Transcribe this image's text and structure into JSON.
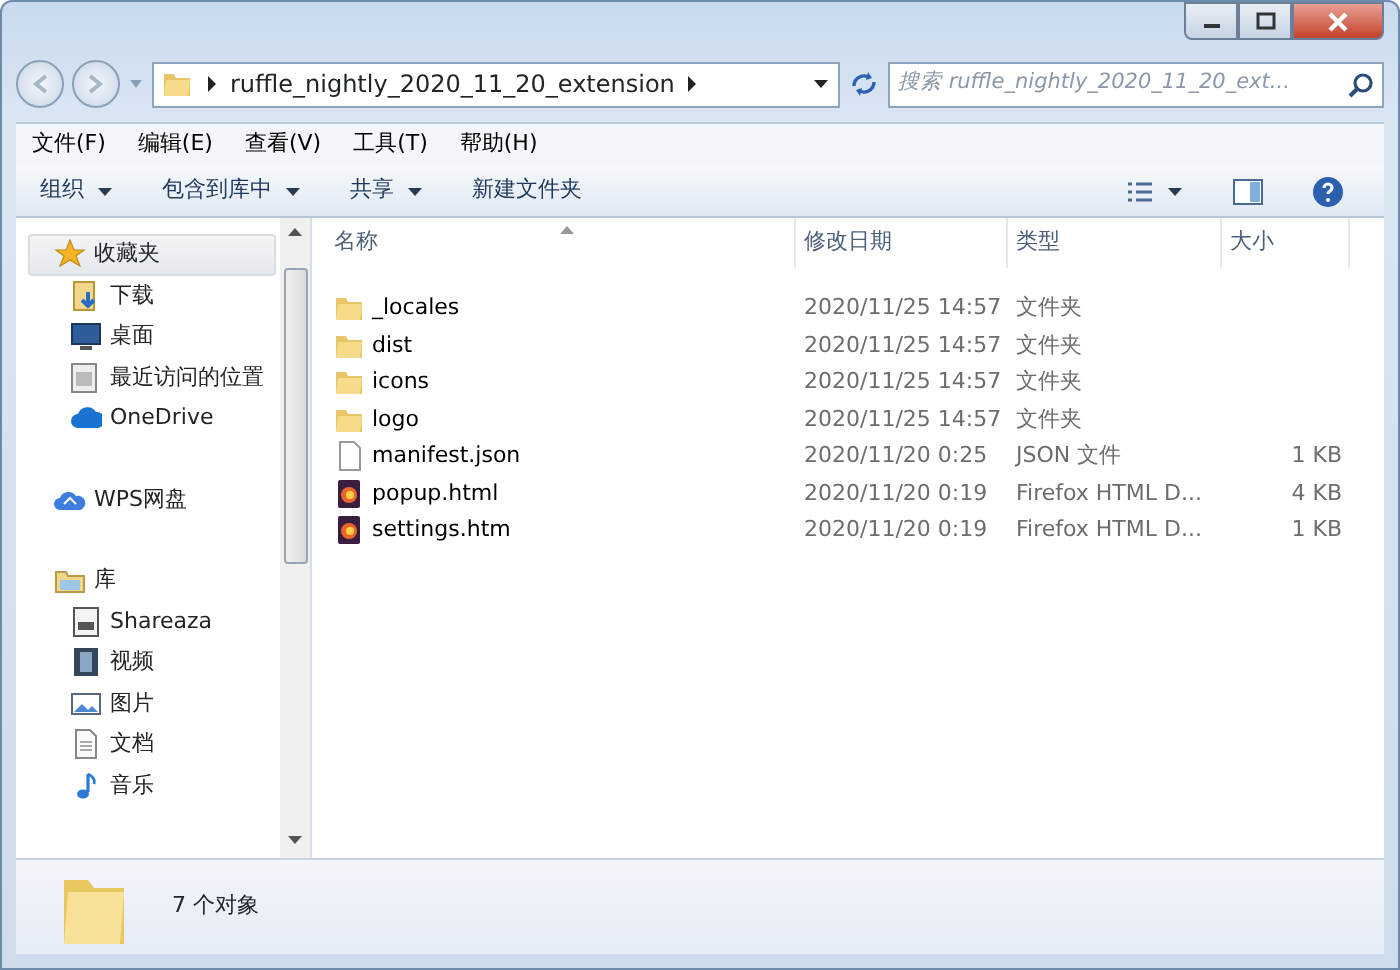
{
  "address": {
    "crumbs": [
      "ruffle_nightly_2020_11_20_extension"
    ]
  },
  "search": {
    "placeholder": "搜索 ruffle_nightly_2020_11_20_ext..."
  },
  "menu": [
    "文件(F)",
    "编辑(E)",
    "查看(V)",
    "工具(T)",
    "帮助(H)"
  ],
  "toolbar": [
    {
      "label": "组织",
      "dropdown": true
    },
    {
      "label": "包含到库中",
      "dropdown": true
    },
    {
      "label": "共享",
      "dropdown": true
    },
    {
      "label": "新建文件夹",
      "dropdown": false
    }
  ],
  "sidebar": [
    {
      "label": "收藏夹",
      "kind": "star",
      "selected": true,
      "children": [
        {
          "label": "下载",
          "kind": "download",
          "selected": false
        },
        {
          "label": "桌面",
          "kind": "desktop",
          "selected": false
        },
        {
          "label": "最近访问的位置",
          "kind": "recent",
          "selected": false
        },
        {
          "label": "OneDrive",
          "kind": "cloud",
          "selected": false
        }
      ]
    },
    {
      "label": "WPS网盘",
      "kind": "netdisk",
      "selected": false
    },
    {
      "label": "库",
      "kind": "library",
      "selected": false,
      "children": [
        {
          "label": "Shareaza",
          "kind": "shareaza",
          "selected": false
        },
        {
          "label": "视频",
          "kind": "video",
          "selected": false
        },
        {
          "label": "图片",
          "kind": "picture",
          "selected": false
        },
        {
          "label": "文档",
          "kind": "document",
          "selected": false
        },
        {
          "label": "音乐",
          "kind": "music",
          "selected": false
        }
      ]
    }
  ],
  "columns": [
    {
      "label": "名称",
      "sorted": true
    },
    {
      "label": "修改日期",
      "sorted": false
    },
    {
      "label": "类型",
      "sorted": false
    },
    {
      "label": "大小",
      "sorted": false
    }
  ],
  "files": [
    {
      "name": "_locales",
      "modified": "2020/11/25 14:57",
      "type": "文件夹",
      "kind": "folder"
    },
    {
      "name": "dist",
      "modified": "2020/11/25 14:57",
      "type": "文件夹",
      "kind": "folder"
    },
    {
      "name": "icons",
      "modified": "2020/11/25 14:57",
      "type": "文件夹",
      "kind": "folder"
    },
    {
      "name": "logo",
      "modified": "2020/11/25 14:57",
      "type": "文件夹",
      "kind": "folder"
    },
    {
      "name": "manifest.json",
      "modified": "2020/11/20 0:25",
      "type": "JSON 文件",
      "size": "1 KB",
      "kind": "file"
    },
    {
      "name": "popup.html",
      "modified": "2020/11/20 0:19",
      "type": "Firefox HTML D...",
      "size": "4 KB",
      "kind": "firefox"
    },
    {
      "name": "settings.htm",
      "modified": "2020/11/20 0:19",
      "type": "Firefox HTML D...",
      "size": "1 KB",
      "kind": "firefox"
    }
  ],
  "status": {
    "text": "7 个对象"
  }
}
